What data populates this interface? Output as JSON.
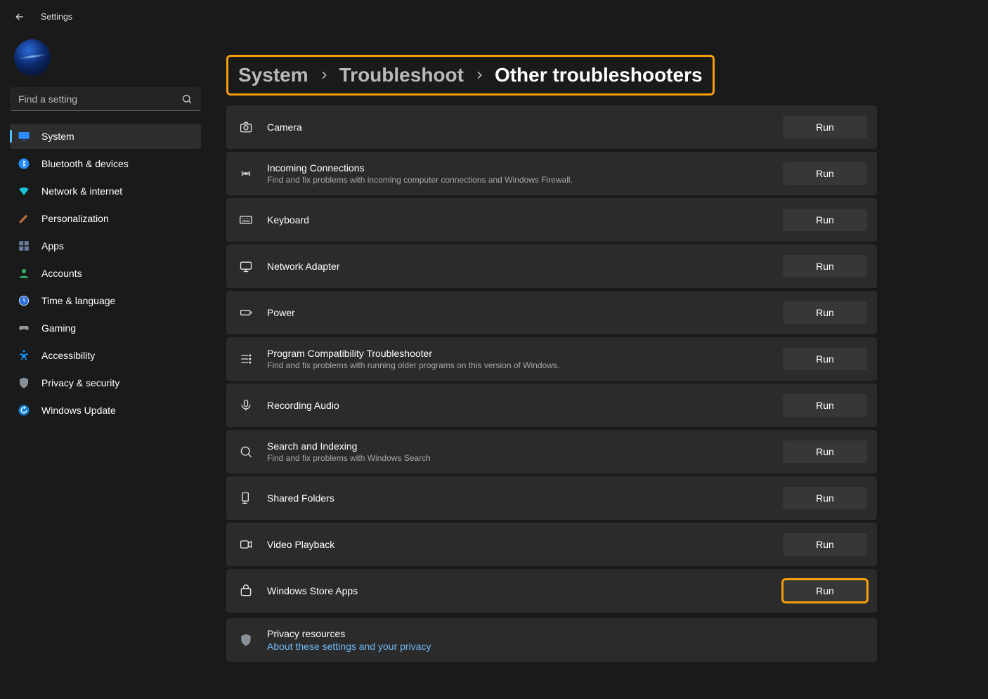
{
  "window_title": "Settings",
  "search": {
    "placeholder": "Find a setting"
  },
  "sidebar": {
    "items": [
      {
        "label": "System"
      },
      {
        "label": "Bluetooth & devices"
      },
      {
        "label": "Network & internet"
      },
      {
        "label": "Personalization"
      },
      {
        "label": "Apps"
      },
      {
        "label": "Accounts"
      },
      {
        "label": "Time & language"
      },
      {
        "label": "Gaming"
      },
      {
        "label": "Accessibility"
      },
      {
        "label": "Privacy & security"
      },
      {
        "label": "Windows Update"
      }
    ]
  },
  "breadcrumb": {
    "part1": "System",
    "part2": "Troubleshoot",
    "current": "Other troubleshooters"
  },
  "buttons": {
    "run": "Run"
  },
  "troubleshooters": [
    {
      "title": "Camera",
      "desc": ""
    },
    {
      "title": "Incoming Connections",
      "desc": "Find and fix problems with incoming computer connections and Windows Firewall."
    },
    {
      "title": "Keyboard",
      "desc": ""
    },
    {
      "title": "Network Adapter",
      "desc": ""
    },
    {
      "title": "Power",
      "desc": ""
    },
    {
      "title": "Program Compatibility Troubleshooter",
      "desc": "Find and fix problems with running older programs on this version of Windows."
    },
    {
      "title": "Recording Audio",
      "desc": ""
    },
    {
      "title": "Search and Indexing",
      "desc": "Find and fix problems with Windows Search"
    },
    {
      "title": "Shared Folders",
      "desc": ""
    },
    {
      "title": "Video Playback",
      "desc": ""
    },
    {
      "title": "Windows Store Apps",
      "desc": ""
    }
  ],
  "privacy": {
    "title": "Privacy resources",
    "link": "About these settings and your privacy"
  }
}
